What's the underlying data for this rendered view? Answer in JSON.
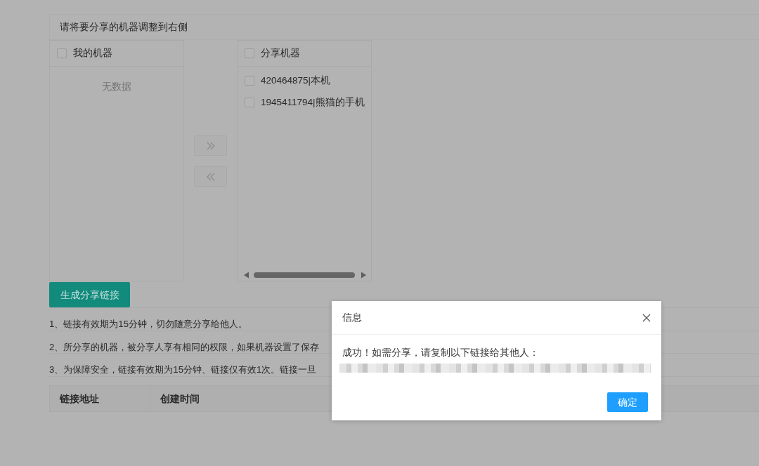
{
  "panel": {
    "title": "请将要分享的机器调整到右侧"
  },
  "transfer": {
    "left": {
      "title": "我的机器",
      "checked": false,
      "empty_text": "无数据"
    },
    "buttons": [
      {
        "kind": "right",
        "disabled": true
      },
      {
        "kind": "left",
        "disabled": true
      }
    ],
    "right": {
      "title": "分享机器",
      "checked": false,
      "items": [
        {
          "label": "420464875|本机",
          "checked": false
        },
        {
          "label": "1945411794|熊猫的手机",
          "checked": false
        }
      ]
    }
  },
  "generate_button": {
    "label": "生成分享链接"
  },
  "notes": [
    "1、链接有效期为15分钟，切勿随意分享给他人。",
    "2、所分享的机器，被分享人享有相同的权限，如果机器设置了保存",
    "3、为保障安全，链接有效期为15分钟、链接仅有效1次。链接一旦"
  ],
  "table": {
    "columns": [
      "链接地址",
      "创建时间"
    ]
  },
  "dialog": {
    "title": "信息",
    "message": "成功！如需分享，请复制以下链接给其他人：",
    "confirm_button": "确定"
  }
}
